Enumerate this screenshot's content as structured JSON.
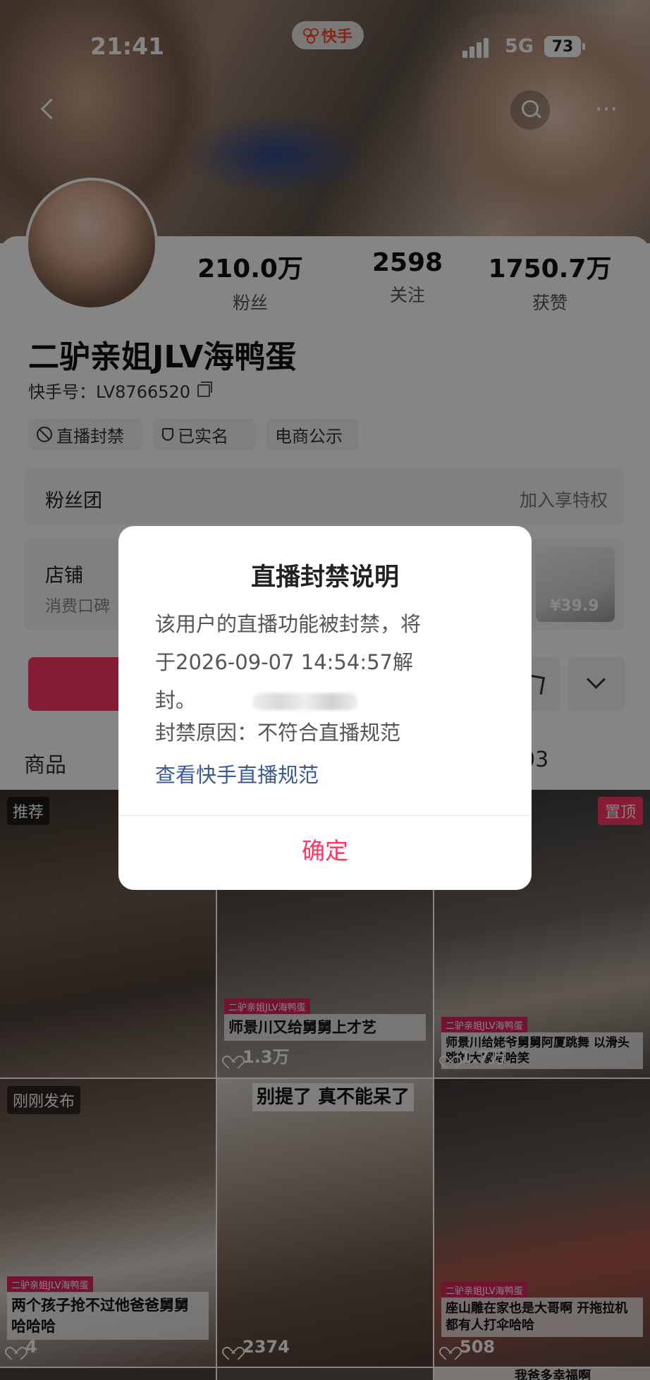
{
  "status_bar": {
    "time": "21:41",
    "network": "5G",
    "battery": "73"
  },
  "app_pill": {
    "label": "快手",
    "brand_color": "#ff4a34"
  },
  "nav": {
    "back_icon": "chevron-left-icon",
    "search_icon": "search-icon",
    "more_label": "···"
  },
  "profile": {
    "stats": [
      {
        "value": "210.0万",
        "label": "粉丝"
      },
      {
        "value": "2598",
        "label": "关注"
      },
      {
        "value": "1750.7万",
        "label": "获赞"
      }
    ],
    "nickname": "二驴亲姐JLV海鸭蛋",
    "user_id": "快手号：LV8766520",
    "tags": [
      "直播封禁",
      "已实名",
      "电商公示"
    ]
  },
  "fans_club": {
    "title": "粉丝团",
    "action": "加入享特权"
  },
  "shop": {
    "title": "店铺",
    "subtitle": "消费口碑",
    "price": "¥39.9"
  },
  "tabs": {
    "left": "商品",
    "right": "03"
  },
  "videos": [
    {
      "badge": "推荐",
      "caption": "",
      "likes": ""
    },
    {
      "badge": "",
      "owner_tag": "二驴亲姐JLV海鸭蛋",
      "caption": "师景川又给舅舅上才艺",
      "likes": "1.3万"
    },
    {
      "badge": "置顶",
      "owner_tag": "二驴亲姐JLV海鸭蛋",
      "caption": "师景川给姥爷舅舅阿厦跳舞 以滑头跳的大家哈哈笑",
      "likes": "1.7万"
    },
    {
      "badge": "刚刚发布",
      "owner_tag": "二驴亲姐JLV海鸭蛋",
      "caption": "两个孩子抢不过他爸爸舅舅 哈哈哈",
      "likes": "4"
    },
    {
      "badge": "",
      "top_caption": "别提了 真不能呆了",
      "caption": "",
      "likes": "2374"
    },
    {
      "badge": "",
      "owner_tag": "二驴亲姐JLV海鸭蛋",
      "caption": "座山雕在家也是大哥啊 开拖拉机都有人打伞哈哈",
      "likes": "508"
    }
  ],
  "next_row_hint": "我爸多幸福啊",
  "dialog": {
    "title": "直播封禁说明",
    "body_line1": "该用户的直播功能被封禁，将",
    "body_line2": "于2026-09-07 14:54:57解",
    "body_line3": "封。",
    "reason": "封禁原因：不符合直播规范",
    "link": "查看快手直播规范",
    "confirm": "确定",
    "accent": "#fe3666",
    "link_color": "#3a5a94"
  }
}
